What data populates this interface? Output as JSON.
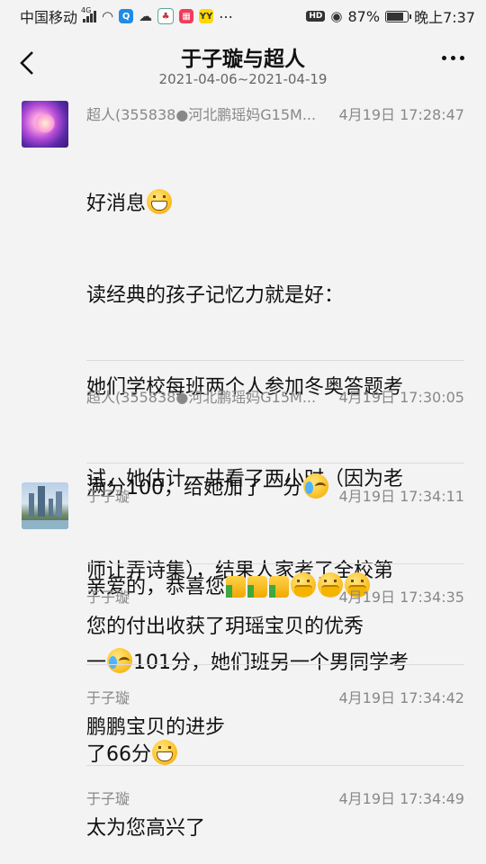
{
  "status_bar": {
    "carrier": "中国移动",
    "network": "4G",
    "battery": "87%",
    "battery_level": 0.87,
    "time": "晚上7:37"
  },
  "header": {
    "title": "于子璇与超人",
    "subtitle": "2021-04-06~2021-04-19"
  },
  "messages": [
    {
      "sender": "超人(355838●河北鹏瑶妈G15M...",
      "time": "4月19日 17:28:47",
      "lines": [
        "好消息",
        "读经典的孩子记忆力就是好：",
        "她们学校每班两个人参加冬奥答题考",
        "试，她估计一共看了两小时（因为老",
        "师让弄诗集），结果人家考了全校第",
        "一",
        "101分，她们班另一个男同学考",
        "了66分"
      ]
    },
    {
      "sender": "超人(355838●河北鹏瑶妈G15M...",
      "time": "4月19日 17:30:05",
      "text": "满分100，给她加了一分"
    },
    {
      "sender": "于子璇",
      "time": "4月19日 17:34:11",
      "text": "亲爱的，恭喜您"
    },
    {
      "sender": "于子璇",
      "time": "4月19日 17:34:35",
      "text": "您的付出收获了玥瑶宝贝的优秀"
    },
    {
      "sender": "于子璇",
      "time": "4月19日 17:34:42",
      "text": "鹏鹏宝贝的进步"
    },
    {
      "sender": "于子璇",
      "time": "4月19日 17:34:49",
      "text": "太为您高兴了"
    }
  ],
  "icons": {
    "back": "back-arrow-icon",
    "more": "more-dots-icon",
    "grin": "grinning-emoji",
    "cry_laugh": "tears-of-joy-emoji",
    "thumb": "thumbs-up-emoji",
    "shy": "covering-mouth-emoji"
  }
}
